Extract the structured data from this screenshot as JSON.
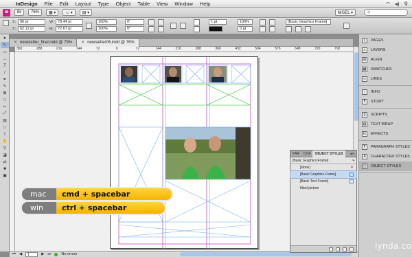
{
  "menubar": {
    "app_name": "InDesign",
    "items": [
      "File",
      "Edit",
      "Layout",
      "Type",
      "Object",
      "Table",
      "View",
      "Window",
      "Help"
    ]
  },
  "appbar": {
    "zoom": "76%",
    "workspace": "NIGEL ▾"
  },
  "control_panel": {
    "x_label": "X:",
    "x_value": "96 pt",
    "y_label": "Y:",
    "y_value": "62.12 pt",
    "w_label": "W:",
    "w_value": "78.44 pt",
    "h_label": "H:",
    "h_value": "72.67 pt",
    "scale_x": "100%",
    "scale_y": "100%",
    "rotate": "0°",
    "shear": "0°",
    "stroke_weight": "1 pt",
    "opacity": "100%",
    "fitting_offset": "0 pt",
    "object_style": "[Basic Graphics Frame]"
  },
  "tabs": [
    {
      "label": "newsletter_final.indd @ 79%",
      "active": false
    },
    {
      "label": "newsletter06.indd @ 76%",
      "active": true
    }
  ],
  "ruler": {
    "labels": [
      "360",
      "288",
      "216",
      "144",
      "72",
      "0",
      "72",
      "144",
      "216",
      "288",
      "360",
      "432",
      "504",
      "576",
      "648",
      "720",
      "792"
    ]
  },
  "status": {
    "page": "1",
    "errors": "No errors"
  },
  "dock": {
    "groups": [
      [
        "PAGES",
        "LAYERS",
        "ALIGN",
        "SWATCHES",
        "LINKS"
      ],
      [
        "INFO",
        "STORY"
      ],
      [
        "SCRIPTS",
        "TEXT WRAP",
        "EFFECTS"
      ],
      [
        "PARAGRAPH STYLES",
        "CHARACTER STYLES",
        "OBJECT STYLES"
      ]
    ]
  },
  "object_styles_panel": {
    "tabs": [
      "PAR",
      "CHA",
      "OBJECT STYLES"
    ],
    "current": "[Basic Graphics Frame]",
    "rows": [
      "[None]",
      "[Basic Graphics Frame]",
      "[Basic Text Frame]",
      "fitted picture"
    ]
  },
  "shortcuts": [
    {
      "os": "mac",
      "combo": "cmd + spacebar"
    },
    {
      "os": "win",
      "combo": "ctrl + spacebar"
    }
  ],
  "watermark": "lynda.com",
  "colors": {
    "selection_accent": "#f4b400",
    "margin_guides": "#cc44cc",
    "column_guides": "#6fa8f0",
    "frame_x": "#7ab0f0",
    "green_guide": "#5ed35e"
  }
}
